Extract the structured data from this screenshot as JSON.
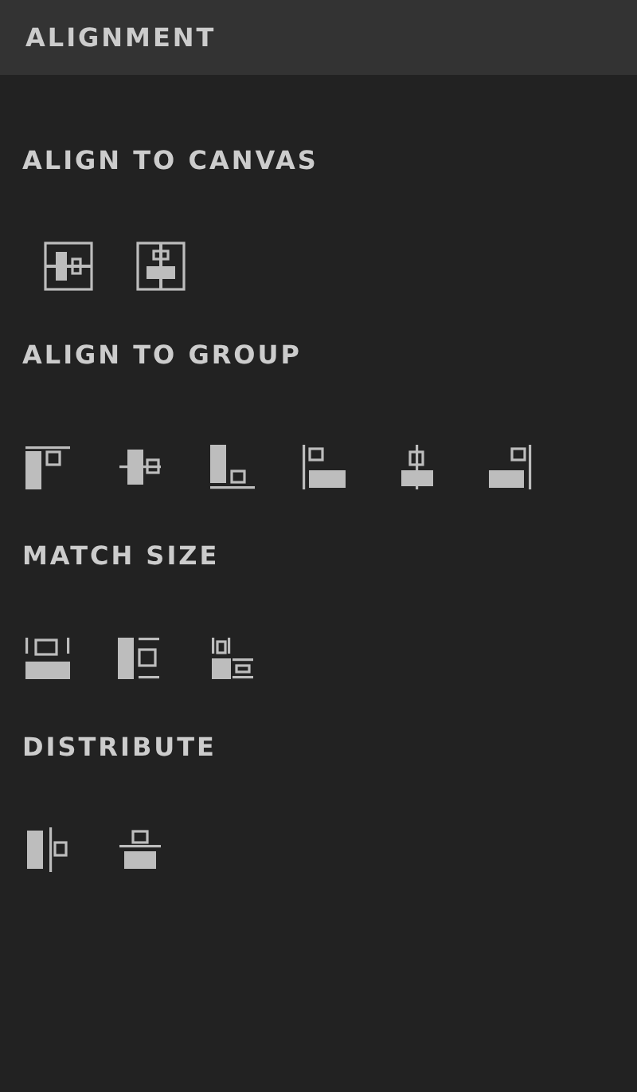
{
  "panel": {
    "title": "ALIGNMENT"
  },
  "sections": [
    {
      "title": "ALIGN TO CANVAS"
    },
    {
      "title": "ALIGN TO GROUP"
    },
    {
      "title": "MATCH SIZE"
    },
    {
      "title": "DISTRIBUTE"
    }
  ]
}
